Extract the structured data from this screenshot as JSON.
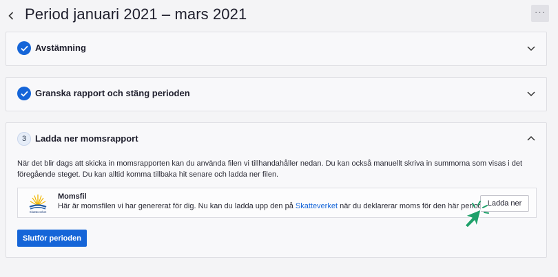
{
  "header": {
    "title": "Period januari 2021 – mars 2021",
    "more_label": "···"
  },
  "steps": [
    {
      "title": "Avstämning",
      "status": "completed",
      "expanded": false
    },
    {
      "title": "Granska rapport och stäng perioden",
      "status": "completed",
      "expanded": false
    },
    {
      "number": "3",
      "title": "Ladda ner momsrapport",
      "status": "active",
      "expanded": true,
      "description": "När det blir dags att skicka in momsrapporten kan du använda filen vi tillhandahåller nedan. Du kan också manuellt skriva in summorna som visas i det föregående steget. Du kan alltid komma tillbaka hit senare och ladda ner filen.",
      "file": {
        "name": "Momsfil",
        "text_before": "Här är momsfilen vi har genererat för dig. Nu kan du ladda upp den på ",
        "link": "Skatteverket",
        "text_after": " när du deklarerar moms för den här perioden.",
        "logo_text": "Skatteverket",
        "download_label": "Ladda ner"
      },
      "finish_label": "Slutför perioden"
    }
  ],
  "colors": {
    "primary": "#1565d8",
    "background": "#f4f4f6",
    "card": "#f8f8fa",
    "cursor": "#1fa06a"
  }
}
